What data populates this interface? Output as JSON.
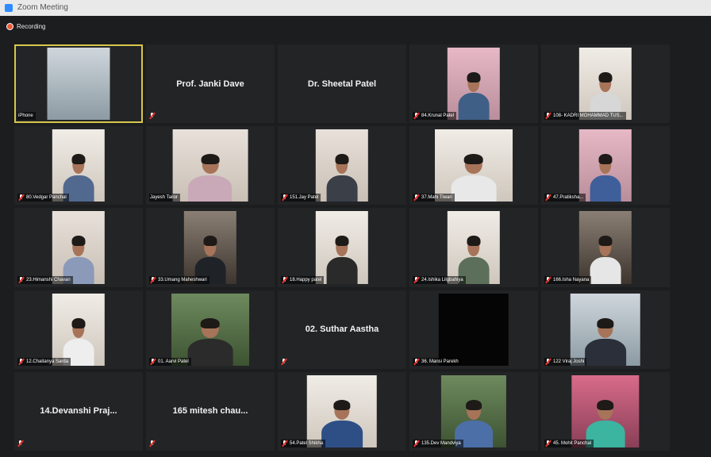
{
  "window": {
    "title": "Zoom Meeting"
  },
  "recording": {
    "label": "Recording"
  },
  "participants": [
    {
      "name": "iPhone",
      "video": true
    },
    {
      "name": "Prof. Janki Dave",
      "video": false
    },
    {
      "name": "Dr. Sheetal Patel",
      "video": false
    },
    {
      "name": "84.Krunal Patel",
      "video": true
    },
    {
      "name": "108- KADRI MOHAMMAD TUS...",
      "video": true
    },
    {
      "name": "80.Vedgar Panchal",
      "video": true
    },
    {
      "name": "Jayesh Tailor",
      "video": true
    },
    {
      "name": "151.Jay Patel",
      "video": true
    },
    {
      "name": "37.Mahi Tiwari",
      "video": true
    },
    {
      "name": "47.Pratiksha...",
      "video": true
    },
    {
      "name": "23.Himanshi Chavan",
      "video": true
    },
    {
      "name": "33.Umang Maheshwari",
      "video": true
    },
    {
      "name": "18.Happy patel",
      "video": true
    },
    {
      "name": "24.Ishika Lilgbahiya",
      "video": true
    },
    {
      "name": "166.Isha Nayana",
      "video": true
    },
    {
      "name": "12.Chaitanya Sarda",
      "video": true
    },
    {
      "name": "01. Aarvi Patel",
      "video": true
    },
    {
      "name": "02. Suthar Aastha",
      "video": false
    },
    {
      "name": "36. Mansi Parekh",
      "video": true
    },
    {
      "name": "122 Viraj Joshi",
      "video": true
    },
    {
      "name": "14.Devanshi Praj...",
      "video": false
    },
    {
      "name": "165 mitesh chau...",
      "video": false
    },
    {
      "name": "54.Patel Shikha",
      "video": true
    },
    {
      "name": "135.Dev Mandviya",
      "video": true
    },
    {
      "name": "45. Mohit Panchal",
      "video": true
    }
  ]
}
